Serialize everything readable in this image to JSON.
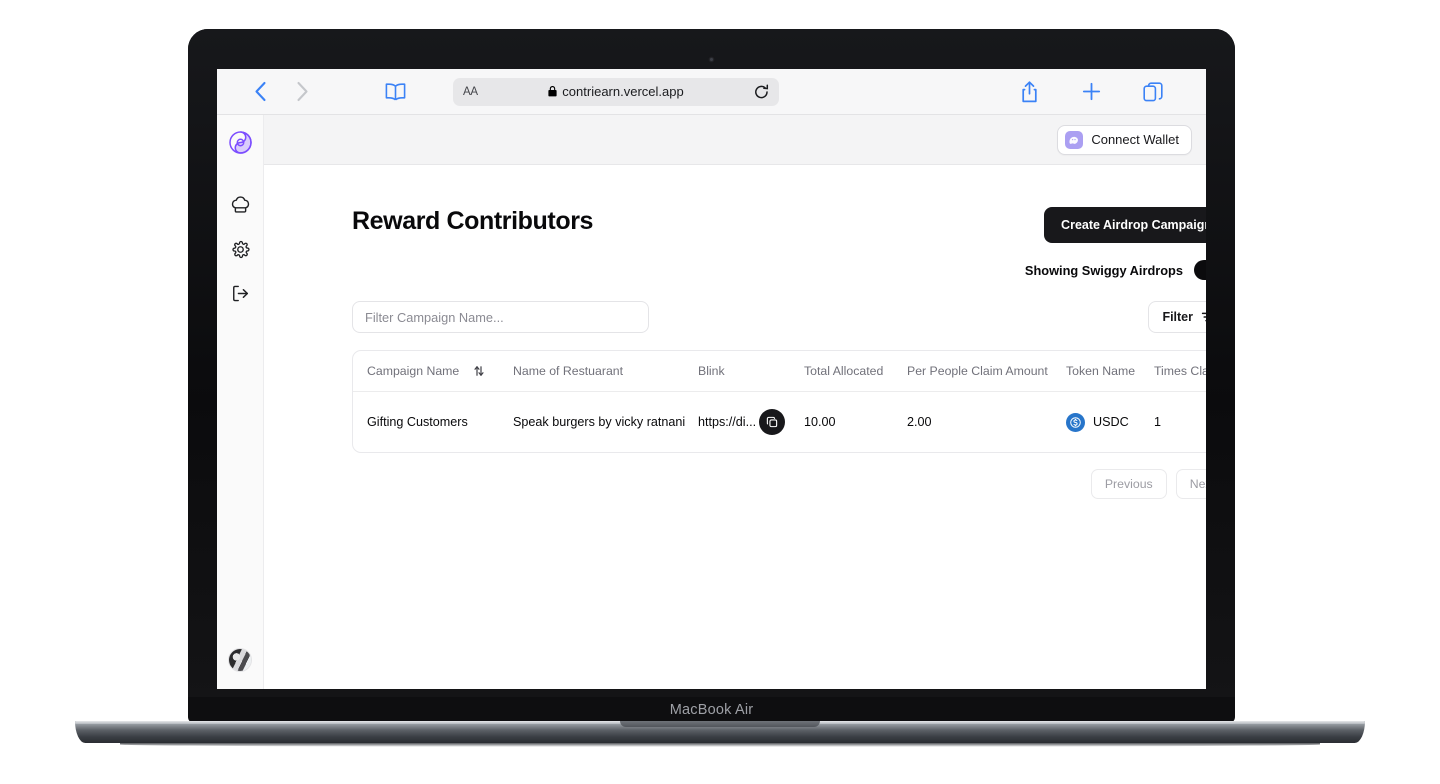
{
  "device": {
    "model_label": "MacBook Air"
  },
  "browser": {
    "back_icon": "chevron-left-icon",
    "forward_icon": "chevron-right-icon",
    "sidebar_icon": "book-icon",
    "text_size_label": "AA",
    "lock_icon": "lock-icon",
    "url": "contriearn.vercel.app",
    "reload_icon": "reload-icon",
    "share_icon": "share-icon",
    "new_tab_icon": "plus-icon",
    "tabs_icon": "tabs-icon"
  },
  "sidebar": {
    "logo_name": "contriearn-logo",
    "items": [
      {
        "name": "chef-hat-icon",
        "label": "Restaurants"
      },
      {
        "name": "gear-icon",
        "label": "Settings"
      },
      {
        "name": "logout-icon",
        "label": "Logout"
      }
    ],
    "avatar_name": "user-avatar"
  },
  "topbar": {
    "connect_wallet_label": "Connect Wallet",
    "wallet_icon": "phantom-wallet-icon",
    "wallet_icon_color": "#ab9ff2"
  },
  "page": {
    "title": "Reward Contributors",
    "create_campaign_label": "Create Airdrop Campaign",
    "toggle_label": "Showing Swiggy Airdrops",
    "toggle_on": true,
    "filter_placeholder": "Filter Campaign Name...",
    "filter_value": "",
    "filter_button_label": "Filter",
    "filter_button_icon": "filter-lines-icon"
  },
  "table": {
    "columns": [
      {
        "key": "campaign",
        "label": "Campaign Name",
        "sortable": true,
        "sort_icon": "sort-arrows-icon"
      },
      {
        "key": "restaurant",
        "label": "Name of Restuarant",
        "sortable": false
      },
      {
        "key": "blink",
        "label": "Blink",
        "sortable": false
      },
      {
        "key": "total",
        "label": "Total Allocated",
        "sortable": false
      },
      {
        "key": "per_person",
        "label": "Per People Claim Amount",
        "sortable": false
      },
      {
        "key": "token",
        "label": "Token Name",
        "sortable": false
      },
      {
        "key": "times",
        "label": "Times Claimed",
        "sortable": false
      }
    ],
    "rows": [
      {
        "campaign": "Gifting Customers",
        "restaurant": "Speak burgers by vicky ratnani",
        "blink": "https://di...",
        "copy_icon": "copy-icon",
        "total": "10.00",
        "per_person": "2.00",
        "token": "USDC",
        "token_icon": "usdc-icon",
        "token_icon_color": "#2775ca",
        "times": "1"
      }
    ]
  },
  "pagination": {
    "previous_label": "Previous",
    "next_label": "Next"
  },
  "theme": {
    "accent": "#7c4dff",
    "primary_button_bg": "#18181b",
    "link_blue": "#3b82f6"
  }
}
